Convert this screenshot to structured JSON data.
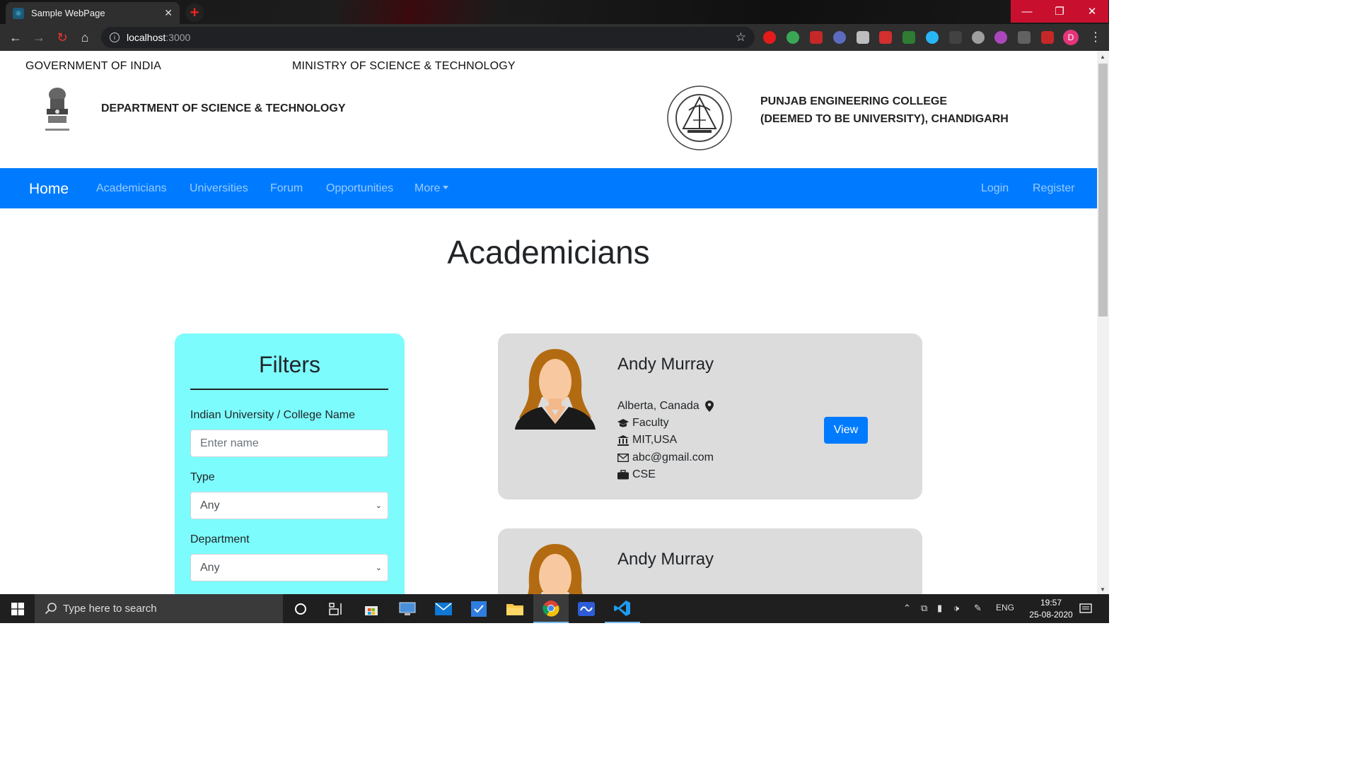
{
  "browser": {
    "tab_title": "Sample WebPage",
    "url_host": "localhost",
    "url_port": ":3000"
  },
  "header": {
    "gov": "GOVERNMENT OF INDIA",
    "ministry": "MINISTRY OF SCIENCE & TECHNOLOGY",
    "department": "DEPARTMENT OF SCIENCE & TECHNOLOGY",
    "college_line1": "PUNJAB ENGINEERING COLLEGE",
    "college_line2": "(DEEMED TO BE UNIVERSITY), CHANDIGARH"
  },
  "nav": {
    "brand": "Home",
    "links": [
      "Academicians",
      "Universities",
      "Forum",
      "Opportunities",
      "More"
    ],
    "login": "Login",
    "register": "Register"
  },
  "page": {
    "title": "Academicians"
  },
  "filters": {
    "title": "Filters",
    "college_label": "Indian University / College Name",
    "college_placeholder": "Enter name",
    "type_label": "Type",
    "type_value": "Any",
    "department_label": "Department",
    "department_value": "Any"
  },
  "academicians": [
    {
      "name": "Andy Murray",
      "location": "Alberta, Canada",
      "role": "Faculty",
      "institution": "MIT,USA",
      "email": "abc@gmail.com",
      "department": "CSE",
      "view_label": "View"
    },
    {
      "name": "Andy Murray"
    }
  ],
  "taskbar": {
    "search_placeholder": "Type here to search",
    "language": "ENG",
    "time": "19:57",
    "date": "25-08-2020"
  },
  "colors": {
    "navbar": "#007bff",
    "filters_bg": "#7dfcfd",
    "card_bg": "#dcdcdc"
  }
}
